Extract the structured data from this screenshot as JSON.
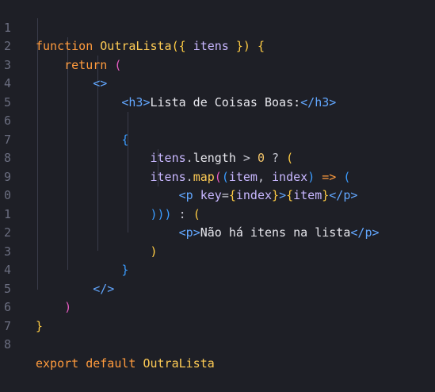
{
  "editor": {
    "line_numbers": [
      "1",
      "2",
      "3",
      "4",
      "5",
      "6",
      "7",
      "8",
      "9",
      "0",
      "1",
      "2",
      "3",
      "4",
      "5",
      "6",
      "7",
      "8"
    ],
    "tokens": {
      "l1_kw": "function",
      "l1_fn": "OutraLista",
      "l1_open": "({",
      "l1_param": "itens",
      "l1_close": "})",
      "l1_brace": "{",
      "l2_kw": "return",
      "l2_paren": "(",
      "l3_frag": "<>",
      "l4_open_lt": "<",
      "l4_open_name": "h3",
      "l4_open_gt": ">",
      "l4_text": "Lista de Coisas Boas:",
      "l4_close_lt": "</",
      "l4_close_name": "h3",
      "l4_close_gt": ">",
      "l6_brace": "{",
      "l7_obj": "itens",
      "l7_dot": ".",
      "l7_prop": "length",
      "l7_op": ">",
      "l7_num": "0",
      "l7_q": "?",
      "l7_paren": "(",
      "l8_obj": "itens",
      "l8_dot": ".",
      "l8_fn": "map",
      "l8_p1": "(",
      "l8_p2": "(",
      "l8_arg1": "item",
      "l8_comma": ",",
      "l8_arg2": "index",
      "l8_p3": ")",
      "l8_arrow": "=>",
      "l8_p4": "(",
      "l9_lt": "<",
      "l9_name": "p",
      "l9_attr": "key",
      "l9_eq": "=",
      "l9_b1": "{",
      "l9_var1": "index",
      "l9_b2": "}",
      "l9_gt": ">",
      "l9_b3": "{",
      "l9_var2": "item",
      "l9_b4": "}",
      "l9_clt": "</",
      "l9_cname": "p",
      "l9_cgt": ">",
      "l10_parens": ")))",
      "l10_colon": ":",
      "l10_paren": "(",
      "l11_lt": "<",
      "l11_name": "p",
      "l11_gt": ">",
      "l11_text": "Não há itens na lista",
      "l11_clt": "</",
      "l11_cname": "p",
      "l11_cgt": ">",
      "l12_paren": ")",
      "l13_brace": "}",
      "l14_frag": "</>",
      "l15_paren": ")",
      "l16_brace": "}",
      "l18_kw1": "export",
      "l18_kw2": "default",
      "l18_name": "OutraLista"
    }
  }
}
